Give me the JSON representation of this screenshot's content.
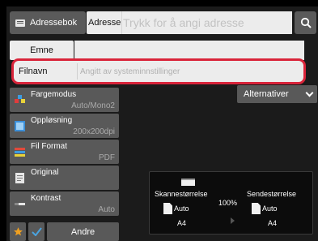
{
  "address_row": {
    "addressbook_label": "Adressebok",
    "address_label": "Adresse",
    "address_placeholder": "Trykk for å angi adresse"
  },
  "subject": {
    "label": "Emne",
    "value": ""
  },
  "filename": {
    "label": "Filnavn",
    "placeholder": "Angitt av systeminnstillinger"
  },
  "settings": [
    {
      "name": "Fargemodus",
      "value": "Auto/Mono2",
      "icon": "color-mode-icon"
    },
    {
      "name": "Oppløsning",
      "value": "200x200dpi",
      "icon": "resolution-icon"
    },
    {
      "name": "Fil Format",
      "value": "PDF",
      "icon": "file-format-icon"
    },
    {
      "name": "Original",
      "value": "",
      "icon": "original-icon"
    },
    {
      "name": "Kontrast",
      "value": "Auto",
      "icon": "contrast-icon"
    }
  ],
  "alternatives_label": "Alternativer",
  "preview": {
    "scan_size_label": "Skannestørrelse",
    "scan_size_mode": "Auto",
    "scan_size_paper": "A4",
    "ratio": "100%",
    "send_size_label": "Sendestørrelse",
    "send_size_mode": "Auto",
    "send_size_paper": "A4"
  },
  "bottom": {
    "other_label": "Andre"
  },
  "colors": {
    "accent_red": "#d9243a",
    "star": "#f0a020",
    "check": "#4aa3df"
  }
}
